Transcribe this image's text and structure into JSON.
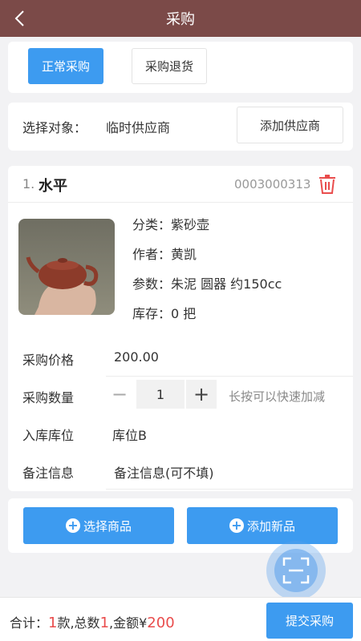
{
  "nav": {
    "title": "采购"
  },
  "segment": {
    "normal": "正常采购",
    "return": "采购退货"
  },
  "supplier": {
    "label": "选择对象：",
    "value": "临时供应商",
    "add_button": "添加供应商"
  },
  "product": {
    "index": "1.",
    "name": "水平",
    "code": "0003000313",
    "category": "分类：紫砂壶",
    "author": "作者：黄凯",
    "params": "参数：朱泥  圆器  约150cc",
    "stock": "库存：0 把"
  },
  "form": {
    "price_label": "采购价格",
    "price_value": "200.00",
    "qty_label": "采购数量",
    "qty_minus": "−",
    "qty_value": "1",
    "qty_plus": "+",
    "qty_hint": "长按可以快速加减",
    "location_label": "入库库位",
    "location_value": "库位B",
    "note_label": "备注信息",
    "note_placeholder": "备注信息(可不填)"
  },
  "actions": {
    "select_goods": "选择商品",
    "add_new": "添加新品",
    "plus_glyph": "+"
  },
  "footer": {
    "prefix": "合计：",
    "count": "1",
    "mid1": "款,总数",
    "total_qty": "1",
    "mid2": ",金额¥",
    "amount": "200",
    "submit": "提交采购"
  },
  "colors": {
    "nav": "#7b4a48",
    "accent": "#3d9bf0",
    "price_red": "#e94c4c",
    "trash": "#e94c4c"
  }
}
